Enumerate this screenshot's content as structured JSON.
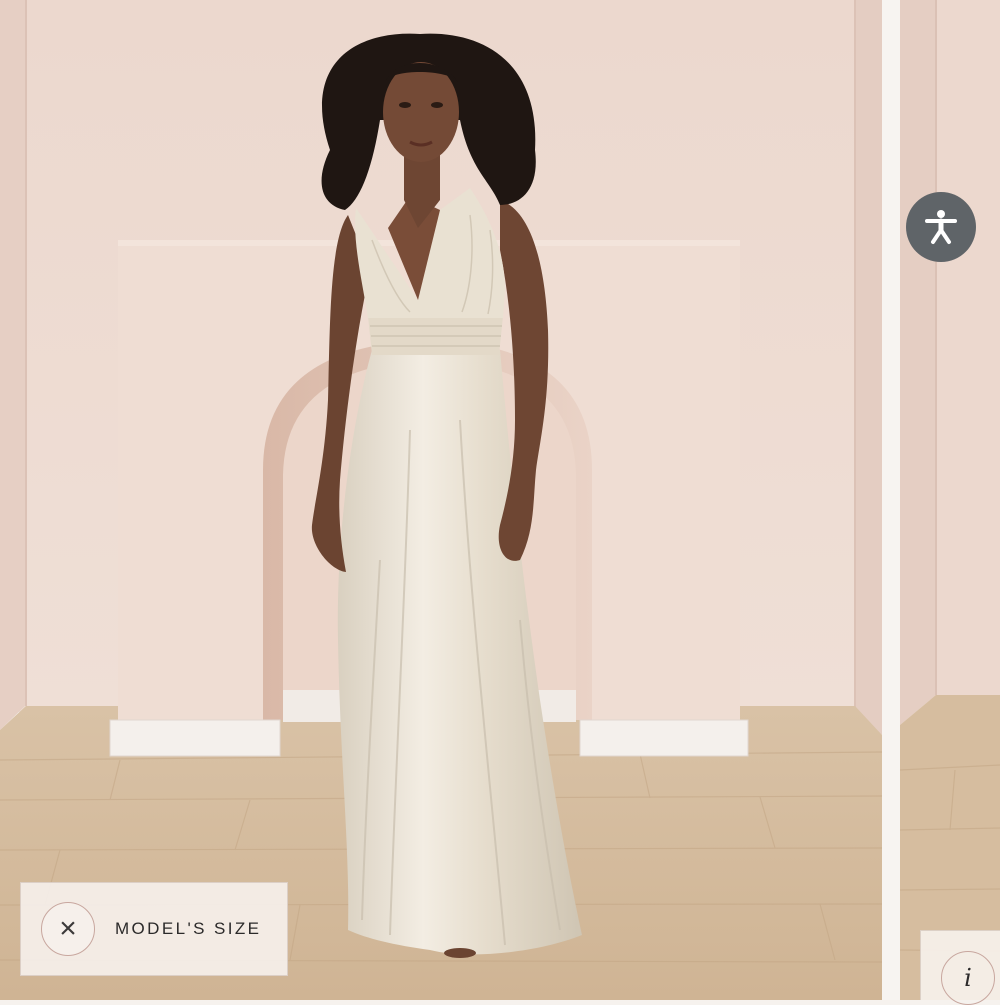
{
  "gallery": {
    "main_photo": {
      "subject": "model in champagne satin halter gown",
      "colors": {
        "wall": "#ecd9d0",
        "floor": "#d4bb9c",
        "gown": "#ece4d6",
        "hair": "#1c1411"
      }
    },
    "next_photo_peek": {
      "colors": {
        "wall": "#ecd9d0",
        "floor": "#d4bb9c"
      }
    }
  },
  "model_size": {
    "close_icon": "close-icon",
    "close_glyph": "×",
    "label": "MODEL'S SIZE"
  },
  "accessibility": {
    "icon": "accessibility-icon"
  },
  "info": {
    "icon": "info-icon",
    "glyph": "i"
  }
}
